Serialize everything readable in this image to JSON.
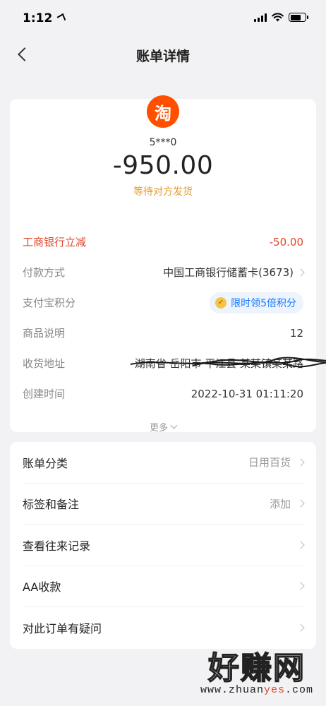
{
  "status_bar": {
    "time": "1:12"
  },
  "nav": {
    "title": "账单详情"
  },
  "merchant": {
    "logo_char": "淘",
    "payee": "5***0",
    "amount": "-950.00",
    "status": "等待对方发货"
  },
  "details": {
    "discount_label": "工商银行立减",
    "discount_value": "-50.00",
    "payment_label": "付款方式",
    "payment_value": "中国工商银行储蓄卡(3673)",
    "points_label": "支付宝积分",
    "points_badge": "限时领5倍积分",
    "product_label": "商品说明",
    "product_value": "12",
    "address_label": "收货地址",
    "address_value": "湖南省 岳阳市 平江县 某某镇某某路",
    "created_label": "创建时间",
    "created_value": "2022-10-31 01:11:20",
    "more_label": "更多"
  },
  "menu": [
    {
      "label": "账单分类",
      "value": "日用百货"
    },
    {
      "label": "标签和备注",
      "value": "添加"
    },
    {
      "label": "查看往来记录",
      "value": ""
    },
    {
      "label": "AA收款",
      "value": ""
    },
    {
      "label": "对此订单有疑问",
      "value": ""
    }
  ],
  "watermark": {
    "big": "好赚网",
    "small_a": "www.zhuan",
    "small_b": "yes",
    "small_c": ".com"
  },
  "colors": {
    "accent_red": "#e0472f",
    "status_orange": "#e59a2c",
    "taobao_orange": "#ff5000",
    "link_blue": "#1677ff"
  }
}
